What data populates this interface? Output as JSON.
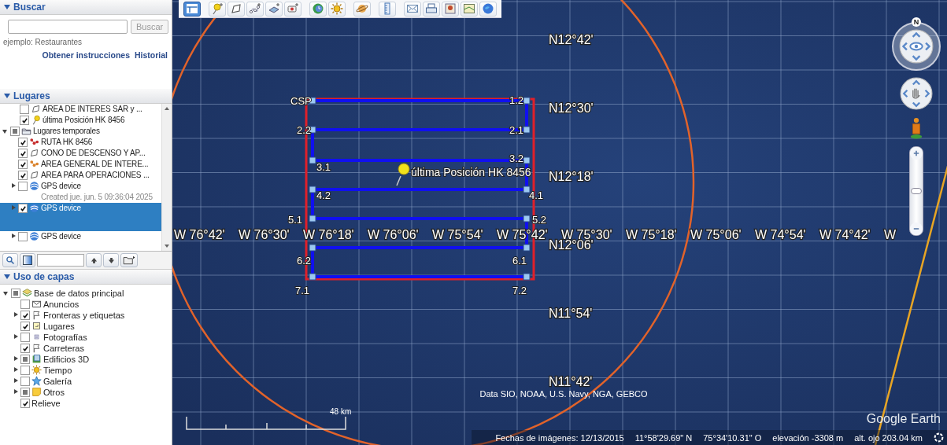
{
  "search": {
    "title": "Buscar",
    "button": "Buscar",
    "hint": "ejemplo: Restaurantes",
    "links": [
      "Obtener instrucciones",
      "Historial"
    ]
  },
  "places": {
    "title": "Lugares",
    "items": [
      {
        "label": "AREA DE INTERES SAR y ...",
        "kind": "polygon",
        "checked": false,
        "expandable": false,
        "selected": false
      },
      {
        "label": "última Posición HK 8456",
        "kind": "pin",
        "checked": true,
        "expandable": false,
        "selected": false
      },
      {
        "label": "Lugares temporales",
        "kind": "folder",
        "checked": false,
        "partial": true,
        "expandable": true,
        "expanded": true,
        "selected": false,
        "children": [
          {
            "label": "RUTA HK 8456",
            "kind": "path",
            "color": "#c62d2d",
            "checked": true,
            "expandable": false,
            "selected": false
          },
          {
            "label": "CONO DE DESCENSO Y AP...",
            "kind": "polygon",
            "checked": true,
            "expandable": false,
            "selected": false
          },
          {
            "label": "AREA GENERAL DE INTERE...",
            "kind": "path",
            "color": "#d9822b",
            "checked": true,
            "expandable": false,
            "selected": false
          },
          {
            "label": "AREA PARA OPERACIONES ...",
            "kind": "polygon",
            "checked": true,
            "expandable": false,
            "selected": false
          },
          {
            "label": "GPS device",
            "subtitle": "Created jue. jun. 5 09:36:04 2025",
            "kind": "gps",
            "checked": false,
            "expandable": true,
            "expanded": false,
            "selected": false
          },
          {
            "label": "GPS device",
            "kind": "gps",
            "checked": true,
            "expandable": true,
            "expanded": false,
            "selected": true
          },
          {
            "label": "GPS device",
            "kind": "gps",
            "checked": false,
            "expandable": true,
            "expanded": false,
            "selected": false
          }
        ]
      }
    ]
  },
  "layers": {
    "title": "Uso de capas",
    "items": [
      {
        "label": "Base de datos principal",
        "kind": "database",
        "checked": false,
        "partial": true,
        "expandable": true,
        "expanded": true,
        "children": [
          {
            "label": "Anuncios",
            "kind": "envelope",
            "checked": false,
            "expandable": false
          },
          {
            "label": "Fronteras y etiquetas",
            "kind": "flag",
            "checked": true,
            "expandable": true,
            "expanded": false
          },
          {
            "label": "Lugares",
            "kind": "label",
            "checked": true,
            "expandable": false
          },
          {
            "label": "Fotografías",
            "kind": "photo",
            "checked": false,
            "expandable": true,
            "expanded": false
          },
          {
            "label": "Carreteras",
            "kind": "flag",
            "checked": true,
            "expandable": false
          },
          {
            "label": "Edificios 3D",
            "kind": "building",
            "checked": false,
            "partial": true,
            "expandable": true,
            "expanded": false
          },
          {
            "label": "Tiempo",
            "kind": "sun",
            "checked": false,
            "expandable": true,
            "expanded": false
          },
          {
            "label": "Galería",
            "kind": "star",
            "checked": false,
            "expandable": true,
            "expanded": false
          },
          {
            "label": "Otros",
            "kind": "note",
            "checked": false,
            "partial": true,
            "expandable": true,
            "expanded": false
          },
          {
            "label": "Relieve",
            "kind": "none",
            "checked": true,
            "expandable": false
          }
        ]
      }
    ]
  },
  "toolbar": [
    {
      "buttons": [
        {
          "kind": "sidebar",
          "selected": true
        }
      ]
    },
    {
      "buttons": [
        {
          "kind": "placemark",
          "selected": false
        },
        {
          "kind": "polygon",
          "selected": false
        },
        {
          "kind": "path",
          "selected": false
        },
        {
          "kind": "overlay",
          "selected": false
        },
        {
          "kind": "tour",
          "selected": false
        }
      ]
    },
    {
      "buttons": [
        {
          "kind": "history",
          "selected": false
        },
        {
          "kind": "sun",
          "selected": false
        }
      ]
    },
    {
      "buttons": [
        {
          "kind": "planets",
          "selected": false
        }
      ]
    },
    {
      "buttons": [
        {
          "kind": "ruler",
          "selected": false
        }
      ]
    },
    {
      "buttons": [
        {
          "kind": "email",
          "selected": false
        },
        {
          "kind": "print",
          "selected": false
        },
        {
          "kind": "save",
          "selected": false
        },
        {
          "kind": "maps",
          "selected": false
        },
        {
          "kind": "earth",
          "selected": false
        }
      ]
    }
  ],
  "map": {
    "latitude_labels": [
      "N12°42'",
      "N12°30'",
      "N12°18'",
      "N12°06'",
      "N11°54'",
      "N11°42'"
    ],
    "longitude_labels": [
      "W 76°42'",
      "W 76°30'",
      "W 76°18'",
      "W 76°06'",
      "W 75°54'",
      "W 75°42'",
      "W 75°30'",
      "W 75°18'",
      "W 75°06'",
      "W 74°54'",
      "W 74°42'",
      "W"
    ],
    "waypoints": [
      "CSP",
      "1.2",
      "2.2",
      "2.1",
      "3.1",
      "3.2",
      "4.2",
      "4.1",
      "5.1",
      "5.2",
      "6.2",
      "6.1",
      "7.1",
      "7.2"
    ],
    "placemark": "última Posición HK 8456",
    "attribution": "Data SIO, NOAA, U.S. Navy, NGA, GEBCO",
    "scale": "48 km",
    "logo": "Google Earth",
    "compass_label": "N",
    "zoom_slider": {
      "level": 0.5
    }
  },
  "status_bar": [
    "Fechas de imágenes: 12/13/2015",
    "11°58'29.69\" N",
    "75°34'10.31\" O",
    "elevación -3308 m",
    "alt. ojo 203.04 km"
  ]
}
